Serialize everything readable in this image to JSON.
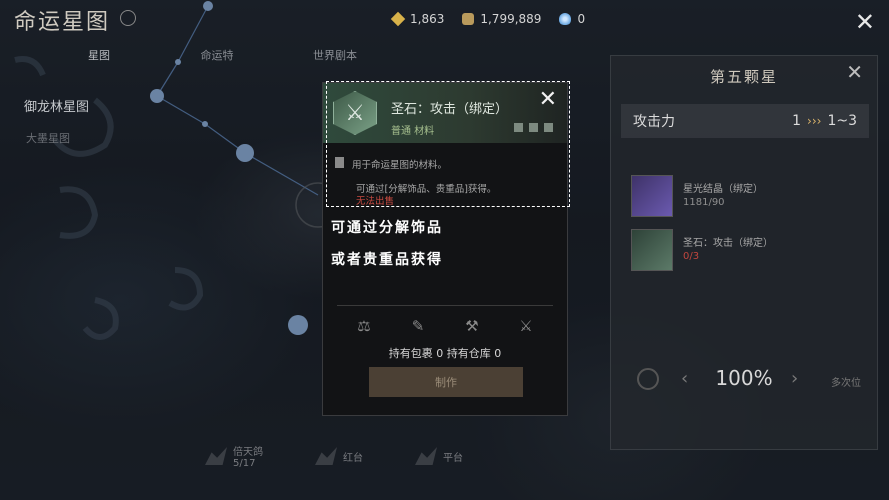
{
  "header": {
    "title": "命运星图",
    "resources": [
      {
        "icon": "gold-diamond-icon",
        "value": "1,863"
      },
      {
        "icon": "coin-pouch-icon",
        "value": "1,799,889"
      },
      {
        "icon": "spirit-flame-icon",
        "value": "0"
      }
    ]
  },
  "tabs": [
    "星图",
    "命运特",
    "世界剧本"
  ],
  "left": {
    "constellation_name": "御龙林星图",
    "sub_label": "大墨星图"
  },
  "right_panel": {
    "title": "第五颗星",
    "stat": {
      "label": "攻击力",
      "from": "1",
      "arrows": "›››",
      "to": "1~3"
    },
    "materials": [
      {
        "name": "星光结晶（绑定）",
        "count": "1181/90",
        "thumb": "star-crystal-icon"
      },
      {
        "name": "圣石：攻击（绑定）",
        "count": "0/3",
        "thumb": "holy-stone-icon"
      }
    ],
    "success_rate": "100%",
    "auto_label": "多次位"
  },
  "bottom_nav": [
    {
      "label": "倍天鸽",
      "sub": "5/17"
    },
    {
      "label": "红台",
      "sub": ""
    },
    {
      "label": "平台",
      "sub": ""
    }
  ],
  "tooltip": {
    "item_name": "圣石：攻击（绑定）",
    "item_type": "普通 材料",
    "description": "用于命运星图的材料。",
    "source": "可通过[分解饰品、贵重品]获得。",
    "restriction": "无法出售",
    "caption_line1": "可通过分解饰品",
    "caption_line2": "或者贵重品获得",
    "holdings": "持有包裹 0   持有仓库 0",
    "craft_button": "制作",
    "actions": [
      "scale-icon",
      "disassemble-icon",
      "anvil-icon",
      "hammer-icon"
    ]
  },
  "colors": {
    "highlight_border": "#ffffff",
    "restriction_red": "#c84a40",
    "item_type_green": "#a7c08f",
    "stat_arrows_gold": "#d9b36a"
  }
}
